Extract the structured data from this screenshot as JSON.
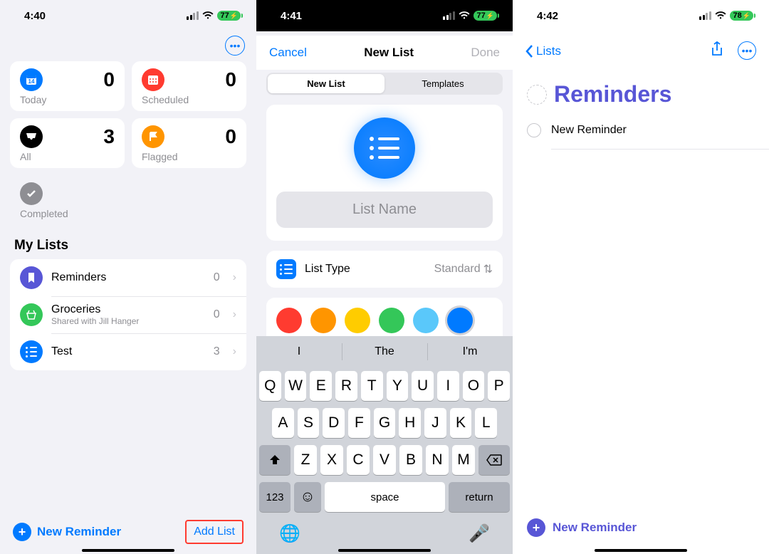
{
  "statusbars": {
    "p1": {
      "time": "4:40",
      "battery": "77"
    },
    "p2": {
      "time": "4:41",
      "battery": "77"
    },
    "p3": {
      "time": "4:42",
      "battery": "78"
    }
  },
  "pane1": {
    "cards": {
      "today": {
        "label": "Today",
        "count": "0"
      },
      "scheduled": {
        "label": "Scheduled",
        "count": "0"
      },
      "all": {
        "label": "All",
        "count": "3"
      },
      "flagged": {
        "label": "Flagged",
        "count": "0"
      },
      "completed": {
        "label": "Completed"
      }
    },
    "section_title": "My Lists",
    "lists": [
      {
        "name": "Reminders",
        "sub": "",
        "count": "0"
      },
      {
        "name": "Groceries",
        "sub": "Shared with Jill Hanger",
        "count": "0"
      },
      {
        "name": "Test",
        "sub": "",
        "count": "3"
      }
    ],
    "new_reminder": "New Reminder",
    "add_list": "Add List"
  },
  "pane2": {
    "nav": {
      "cancel": "Cancel",
      "title": "New List",
      "done": "Done"
    },
    "segment": {
      "new_list": "New List",
      "templates": "Templates"
    },
    "name_placeholder": "List Name",
    "list_type": {
      "label": "List Type",
      "value": "Standard"
    },
    "colors": [
      "#ff3b30",
      "#ff9500",
      "#ffcc00",
      "#34c759",
      "#5ac8fa",
      "#007aff",
      "#5856d6",
      "#ff2d55",
      "#af52de",
      "#a2845e",
      "#636366",
      "#d4a5a5"
    ],
    "selected_color_index": 5,
    "keyboard": {
      "suggestions": [
        "I",
        "The",
        "I'm"
      ],
      "row1": [
        "Q",
        "W",
        "E",
        "R",
        "T",
        "Y",
        "U",
        "I",
        "O",
        "P"
      ],
      "row2": [
        "A",
        "S",
        "D",
        "F",
        "G",
        "H",
        "J",
        "K",
        "L"
      ],
      "row3": [
        "Z",
        "X",
        "C",
        "V",
        "B",
        "N",
        "M"
      ],
      "k123": "123",
      "space": "space",
      "return": "return"
    }
  },
  "pane3": {
    "back": "Lists",
    "title": "Reminders",
    "todo": "New Reminder",
    "new_reminder": "New Reminder"
  }
}
